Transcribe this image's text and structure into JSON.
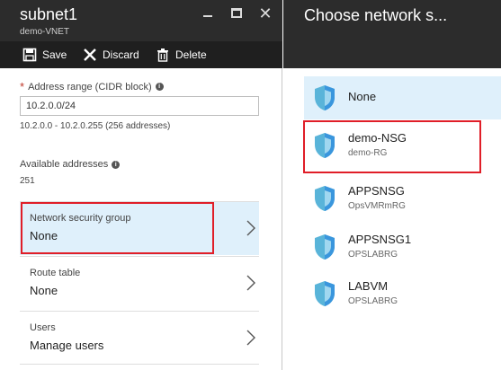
{
  "left_blade": {
    "title": "subnet1",
    "subtitle": "demo-VNET",
    "toolbar": {
      "save": "Save",
      "discard": "Discard",
      "delete": "Delete"
    },
    "address_range": {
      "label": "Address range (CIDR block)",
      "value": "10.2.0.0/24",
      "hint": "10.2.0.0 - 10.2.0.255 (256 addresses)"
    },
    "available_addresses": {
      "label": "Available addresses",
      "value": "251"
    },
    "nav_rows": [
      {
        "label": "Network security group",
        "value": "None"
      },
      {
        "label": "Route table",
        "value": "None"
      },
      {
        "label": "Users",
        "value": "Manage users"
      }
    ]
  },
  "right_blade": {
    "title": "Choose network s...",
    "items": [
      {
        "name": "None",
        "rg": ""
      },
      {
        "name": "demo-NSG",
        "rg": "demo-RG"
      },
      {
        "name": "APPSNSG",
        "rg": "OpsVMRmRG"
      },
      {
        "name": "APPSNSG1",
        "rg": "OPSLABRG"
      },
      {
        "name": "LABVM",
        "rg": "OPSLABRG"
      }
    ]
  },
  "colors": {
    "header_bg": "#2c2c2c",
    "toolbar_bg": "#1f1f1f",
    "selected_bg": "#dff0fb",
    "highlight_border": "#e01e28",
    "shield_blue": "#3a96dd"
  }
}
